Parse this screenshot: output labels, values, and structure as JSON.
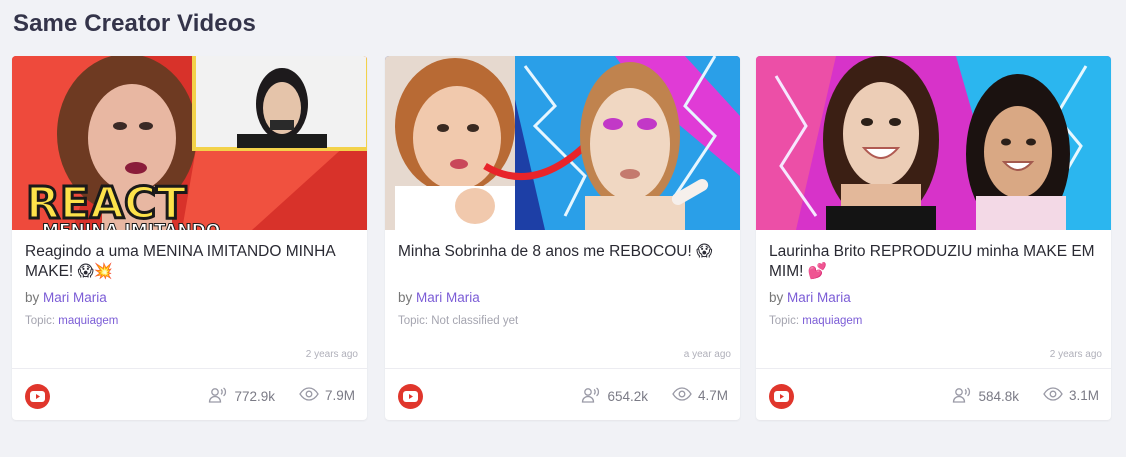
{
  "section": {
    "title": "Same Creator Videos"
  },
  "videos": [
    {
      "title": "Reagindo a uma MENINA IMITANDO MINHA MAKE! 😱💥",
      "by_prefix": "by",
      "creator": "Mari Maria",
      "topic_label": "Topic:",
      "topic": "maquiagem",
      "age": "2 years ago",
      "platform_icon": "youtube-icon",
      "subscribers": "772.9k",
      "views": "7.9M",
      "thumb_text_1": "REACT",
      "thumb_text_2": "MENINA IMITANDO"
    },
    {
      "title": "Minha Sobrinha de 8 anos me REBOCOU! 😱",
      "by_prefix": "by",
      "creator": "Mari Maria",
      "topic_label": "Topic:",
      "topic": "Not classified yet",
      "age": "a year ago",
      "platform_icon": "youtube-icon",
      "subscribers": "654.2k",
      "views": "4.7M"
    },
    {
      "title": "Laurinha Brito REPRODUZIU minha MAKE EM MIM! 💕",
      "by_prefix": "by",
      "creator": "Mari Maria",
      "topic_label": "Topic:",
      "topic": "maquiagem",
      "age": "2 years ago",
      "platform_icon": "youtube-icon",
      "subscribers": "584.8k",
      "views": "3.1M"
    }
  ],
  "colors": {
    "accent": "#7b5cd6",
    "youtube": "#e0362c",
    "background": "#f1f2f6"
  },
  "icons": {
    "subscribers": "people-icon",
    "views": "eye-icon"
  }
}
